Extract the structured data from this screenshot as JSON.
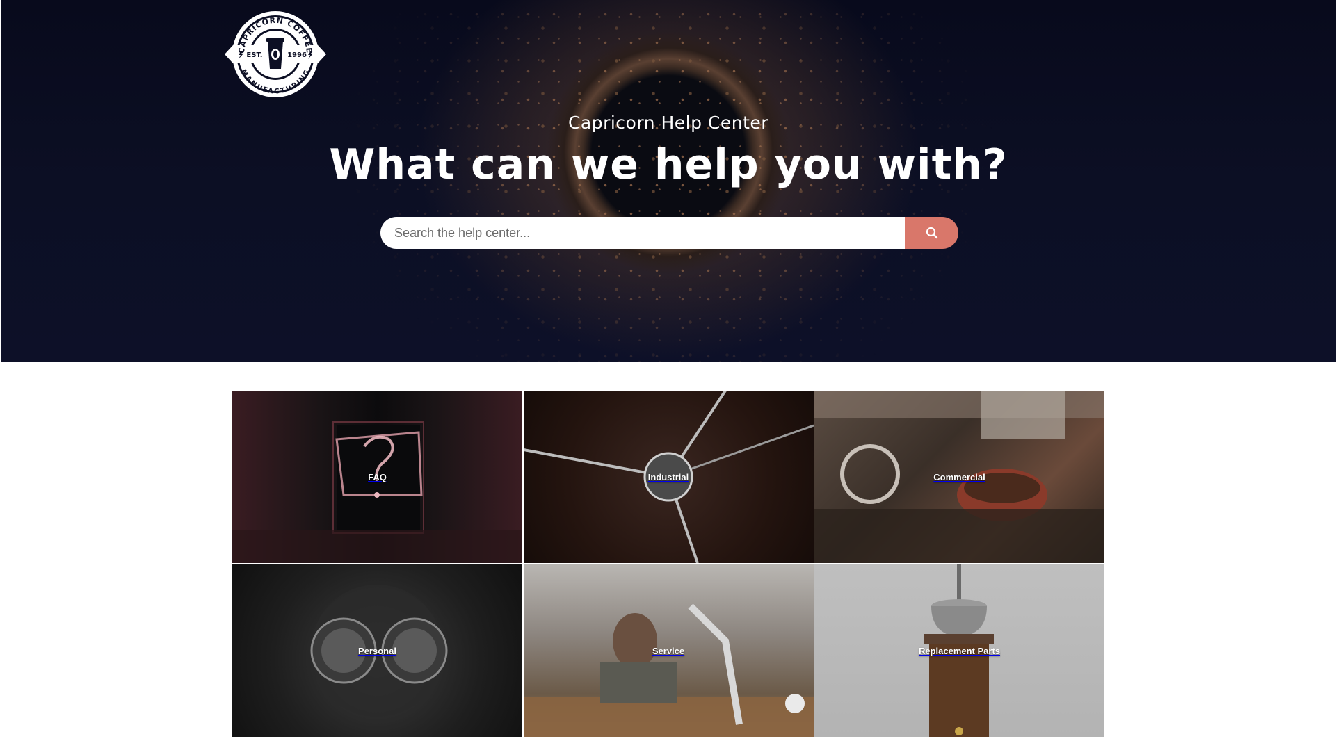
{
  "colors": {
    "hero_bg": "#0c0f24",
    "search_button": "#d9776a",
    "text_light": "#ffffff"
  },
  "logo": {
    "top_text": "CAPRICORN COFFEE",
    "bottom_text": "MANUFACTURING",
    "left_text": "EST.",
    "right_text": "1996"
  },
  "hero": {
    "subtitle": "Capricorn Help Center",
    "headline": "What can we help you with?"
  },
  "search": {
    "placeholder": "Search the help center...",
    "value": "",
    "button_icon": "search-icon"
  },
  "categories": [
    {
      "label": "FAQ"
    },
    {
      "label": "Industrial"
    },
    {
      "label": "Commercial"
    },
    {
      "label": "Personal"
    },
    {
      "label": "Service"
    },
    {
      "label": "Replacement Parts"
    }
  ]
}
